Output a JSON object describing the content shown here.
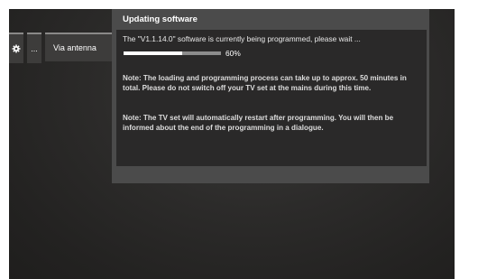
{
  "menu": {
    "items": [
      {
        "icon": "gear-icon",
        "label": ""
      },
      {
        "label": "..."
      },
      {
        "label": "Via antenna"
      }
    ]
  },
  "dialog": {
    "title": "Updating software",
    "message": "The \"V1.1.14.0\" software is currently being programmed, please wait ...",
    "progress": {
      "value": 0.6,
      "label": "60%"
    },
    "note1": "Note: The loading and programming process can take up to approx. 50 minutes in total. Please do not switch off your TV set at the mains during this time.",
    "note2": "Note: The TV set will automatically restart after programming. You will then be informed about the end of the programming in a dialogue."
  }
}
